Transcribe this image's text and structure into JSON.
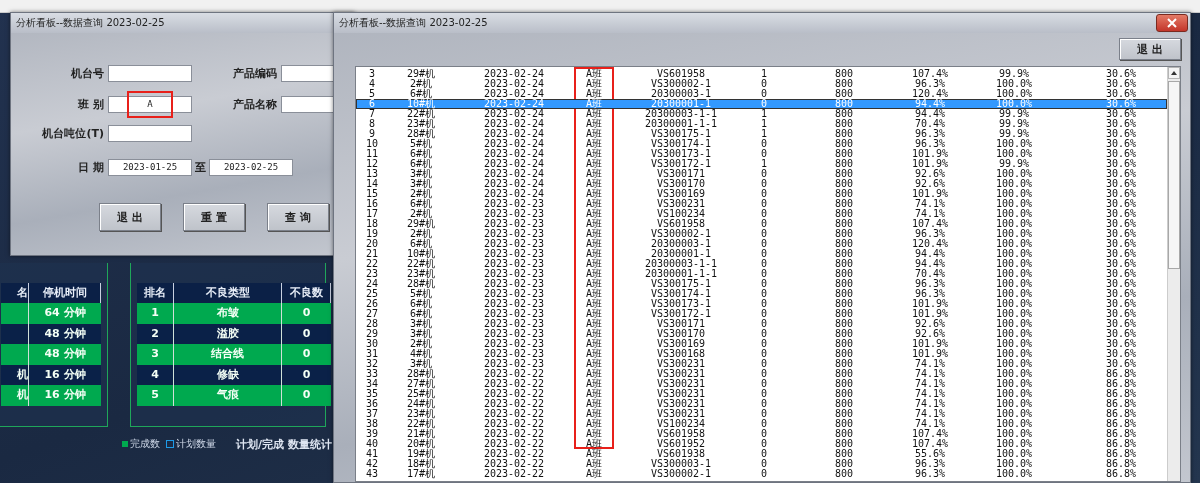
{
  "dashboard": {
    "downtime_table": {
      "columns": [
        "名",
        "停机时间"
      ],
      "rows": [
        {
          "time": "64 分钟"
        },
        {
          "time": "48 分钟"
        },
        {
          "time": "48 分钟"
        },
        {
          "machine": "机",
          "time": "16 分钟"
        },
        {
          "machine": "机",
          "time": "16 分钟"
        }
      ]
    },
    "defect_table": {
      "columns": [
        "排名",
        "不良类型",
        "不良数"
      ],
      "rows": [
        [
          "1",
          "布皱",
          "0"
        ],
        [
          "2",
          "溢胶",
          "0"
        ],
        [
          "3",
          "结合线",
          "0"
        ],
        [
          "4",
          "修缺",
          "0"
        ],
        [
          "5",
          "气痕",
          "0"
        ]
      ]
    },
    "legend": [
      {
        "label": "完成数",
        "kind": "filled"
      },
      {
        "label": "计划数量",
        "kind": "outline"
      }
    ],
    "chart_title": "计划/完成 数量统计"
  },
  "query_dialog": {
    "title": "分析看板--数据查询 2023-02-25",
    "fields": [
      {
        "label": "机台号"
      },
      {
        "label": "产品编码"
      },
      {
        "label": "班 别",
        "value": "A",
        "highlighted": true
      },
      {
        "label": "产品名称"
      },
      {
        "label": "机台吨位(T)"
      }
    ],
    "date": {
      "label": "日 期",
      "from": "2023-01-25",
      "separator": "至",
      "to": "2023-02-25"
    },
    "buttons": [
      "退 出",
      "重 置",
      "查 询"
    ]
  },
  "result_dialog": {
    "title": "分析看板--数据查询 2023-02-25",
    "exit_button": "退 出",
    "shift_column_highlighted": true,
    "rows": [
      {
        "selected": false,
        "cells": [
          "3",
          "29#机",
          "2023-02-24",
          "A班",
          "VS601958",
          "1",
          "800",
          "107.4%",
          "99.9%",
          "30.6%"
        ]
      },
      {
        "selected": false,
        "cells": [
          "4",
          "2#机",
          "2023-02-24",
          "A班",
          "VS300002-1",
          "0",
          "800",
          "96.3%",
          "100.0%",
          "30.6%"
        ]
      },
      {
        "selected": false,
        "cells": [
          "5",
          "6#机",
          "2023-02-24",
          "A班",
          "20300003-1",
          "0",
          "800",
          "120.4%",
          "100.0%",
          "30.6%"
        ]
      },
      {
        "selected": true,
        "cells": [
          "6",
          "10#机",
          "2023-02-24",
          "A班",
          "20300001-1",
          "0",
          "800",
          "94.4%",
          "100.0%",
          "30.6%"
        ]
      },
      {
        "selected": false,
        "cells": [
          "7",
          "22#机",
          "2023-02-24",
          "A班",
          "20300003-1-1",
          "1",
          "800",
          "94.4%",
          "99.9%",
          "30.6%"
        ]
      },
      {
        "selected": false,
        "cells": [
          "8",
          "23#机",
          "2023-02-24",
          "A班",
          "20300001-1-1",
          "1",
          "800",
          "70.4%",
          "99.9%",
          "30.6%"
        ]
      },
      {
        "selected": false,
        "cells": [
          "9",
          "28#机",
          "2023-02-24",
          "A班",
          "VS300175-1",
          "1",
          "800",
          "96.3%",
          "99.9%",
          "30.6%"
        ]
      },
      {
        "selected": false,
        "cells": [
          "10",
          "5#机",
          "2023-02-24",
          "A班",
          "VS300174-1",
          "0",
          "800",
          "96.3%",
          "100.0%",
          "30.6%"
        ]
      },
      {
        "selected": false,
        "cells": [
          "11",
          "6#机",
          "2023-02-24",
          "A班",
          "VS300173-1",
          "0",
          "800",
          "101.9%",
          "100.0%",
          "30.6%"
        ]
      },
      {
        "selected": false,
        "cells": [
          "12",
          "6#机",
          "2023-02-24",
          "A班",
          "VS300172-1",
          "1",
          "800",
          "101.9%",
          "99.9%",
          "30.6%"
        ]
      },
      {
        "selected": false,
        "cells": [
          "13",
          "3#机",
          "2023-02-24",
          "A班",
          "VS300171",
          "0",
          "800",
          "92.6%",
          "100.0%",
          "30.6%"
        ]
      },
      {
        "selected": false,
        "cells": [
          "14",
          "3#机",
          "2023-02-24",
          "A班",
          "VS300170",
          "0",
          "800",
          "92.6%",
          "100.0%",
          "30.6%"
        ]
      },
      {
        "selected": false,
        "cells": [
          "15",
          "2#机",
          "2023-02-24",
          "A班",
          "VS300169",
          "0",
          "800",
          "101.9%",
          "100.0%",
          "30.6%"
        ]
      },
      {
        "selected": false,
        "cells": [
          "16",
          "6#机",
          "2023-02-23",
          "A班",
          "VS300231",
          "0",
          "800",
          "74.1%",
          "100.0%",
          "30.6%"
        ]
      },
      {
        "selected": false,
        "cells": [
          "17",
          "2#机",
          "2023-02-23",
          "A班",
          "VS100234",
          "0",
          "800",
          "74.1%",
          "100.0%",
          "30.6%"
        ]
      },
      {
        "selected": false,
        "cells": [
          "18",
          "29#机",
          "2023-02-23",
          "A班",
          "VS601958",
          "0",
          "800",
          "107.4%",
          "100.0%",
          "30.6%"
        ]
      },
      {
        "selected": false,
        "cells": [
          "19",
          "2#机",
          "2023-02-23",
          "A班",
          "VS300002-1",
          "0",
          "800",
          "96.3%",
          "100.0%",
          "30.6%"
        ]
      },
      {
        "selected": false,
        "cells": [
          "20",
          "6#机",
          "2023-02-23",
          "A班",
          "20300003-1",
          "0",
          "800",
          "120.4%",
          "100.0%",
          "30.6%"
        ]
      },
      {
        "selected": false,
        "cells": [
          "21",
          "10#机",
          "2023-02-23",
          "A班",
          "20300001-1",
          "0",
          "800",
          "94.4%",
          "100.0%",
          "30.6%"
        ]
      },
      {
        "selected": false,
        "cells": [
          "22",
          "22#机",
          "2023-02-23",
          "A班",
          "20300003-1-1",
          "0",
          "800",
          "94.4%",
          "100.0%",
          "30.6%"
        ]
      },
      {
        "selected": false,
        "cells": [
          "23",
          "23#机",
          "2023-02-23",
          "A班",
          "20300001-1-1",
          "0",
          "800",
          "70.4%",
          "100.0%",
          "30.6%"
        ]
      },
      {
        "selected": false,
        "cells": [
          "24",
          "28#机",
          "2023-02-23",
          "A班",
          "VS300175-1",
          "0",
          "800",
          "96.3%",
          "100.0%",
          "30.6%"
        ]
      },
      {
        "selected": false,
        "cells": [
          "25",
          "5#机",
          "2023-02-23",
          "A班",
          "VS300174-1",
          "0",
          "800",
          "96.3%",
          "100.0%",
          "30.6%"
        ]
      },
      {
        "selected": false,
        "cells": [
          "26",
          "6#机",
          "2023-02-23",
          "A班",
          "VS300173-1",
          "0",
          "800",
          "101.9%",
          "100.0%",
          "30.6%"
        ]
      },
      {
        "selected": false,
        "cells": [
          "27",
          "6#机",
          "2023-02-23",
          "A班",
          "VS300172-1",
          "0",
          "800",
          "101.9%",
          "100.0%",
          "30.6%"
        ]
      },
      {
        "selected": false,
        "cells": [
          "28",
          "3#机",
          "2023-02-23",
          "A班",
          "VS300171",
          "0",
          "800",
          "92.6%",
          "100.0%",
          "30.6%"
        ]
      },
      {
        "selected": false,
        "cells": [
          "29",
          "3#机",
          "2023-02-23",
          "A班",
          "VS300170",
          "0",
          "800",
          "92.6%",
          "100.0%",
          "30.6%"
        ]
      },
      {
        "selected": false,
        "cells": [
          "30",
          "2#机",
          "2023-02-23",
          "A班",
          "VS300169",
          "0",
          "800",
          "101.9%",
          "100.0%",
          "30.6%"
        ]
      },
      {
        "selected": false,
        "cells": [
          "31",
          "4#机",
          "2023-02-23",
          "A班",
          "VS300168",
          "0",
          "800",
          "101.9%",
          "100.0%",
          "30.6%"
        ]
      },
      {
        "selected": false,
        "cells": [
          "32",
          "3#机",
          "2023-02-23",
          "A班",
          "VS300231",
          "0",
          "800",
          "74.1%",
          "100.0%",
          "30.6%"
        ]
      },
      {
        "selected": false,
        "cells": [
          "33",
          "28#机",
          "2023-02-22",
          "A班",
          "VS300231",
          "0",
          "800",
          "74.1%",
          "100.0%",
          "86.8%"
        ]
      },
      {
        "selected": false,
        "cells": [
          "34",
          "27#机",
          "2023-02-22",
          "A班",
          "VS300231",
          "0",
          "800",
          "74.1%",
          "100.0%",
          "86.8%"
        ]
      },
      {
        "selected": false,
        "cells": [
          "35",
          "25#机",
          "2023-02-22",
          "A班",
          "VS300231",
          "0",
          "800",
          "74.1%",
          "100.0%",
          "86.8%"
        ]
      },
      {
        "selected": false,
        "cells": [
          "36",
          "24#机",
          "2023-02-22",
          "A班",
          "VS300231",
          "0",
          "800",
          "74.1%",
          "100.0%",
          "86.8%"
        ]
      },
      {
        "selected": false,
        "cells": [
          "37",
          "23#机",
          "2023-02-22",
          "A班",
          "VS300231",
          "0",
          "800",
          "74.1%",
          "100.0%",
          "86.8%"
        ]
      },
      {
        "selected": false,
        "cells": [
          "38",
          "22#机",
          "2023-02-22",
          "A班",
          "VS100234",
          "0",
          "800",
          "74.1%",
          "100.0%",
          "86.8%"
        ]
      },
      {
        "selected": false,
        "cells": [
          "39",
          "21#机",
          "2023-02-22",
          "A班",
          "VS601958",
          "0",
          "800",
          "107.4%",
          "100.0%",
          "86.8%"
        ]
      },
      {
        "selected": false,
        "cells": [
          "40",
          "20#机",
          "2023-02-22",
          "A班",
          "VS601952",
          "0",
          "800",
          "107.4%",
          "100.0%",
          "86.8%"
        ]
      },
      {
        "selected": false,
        "cells": [
          "41",
          "19#机",
          "2023-02-22",
          "A班",
          "VS601938",
          "0",
          "800",
          "55.6%",
          "100.0%",
          "86.8%"
        ]
      },
      {
        "selected": false,
        "cells": [
          "42",
          "18#机",
          "2023-02-22",
          "A班",
          "VS300003-1",
          "0",
          "800",
          "96.3%",
          "100.0%",
          "86.8%"
        ]
      },
      {
        "selected": false,
        "cells": [
          "43",
          "17#机",
          "2023-02-22",
          "A班",
          "VS300002-1",
          "0",
          "800",
          "96.3%",
          "100.0%",
          "86.8%"
        ]
      }
    ]
  }
}
